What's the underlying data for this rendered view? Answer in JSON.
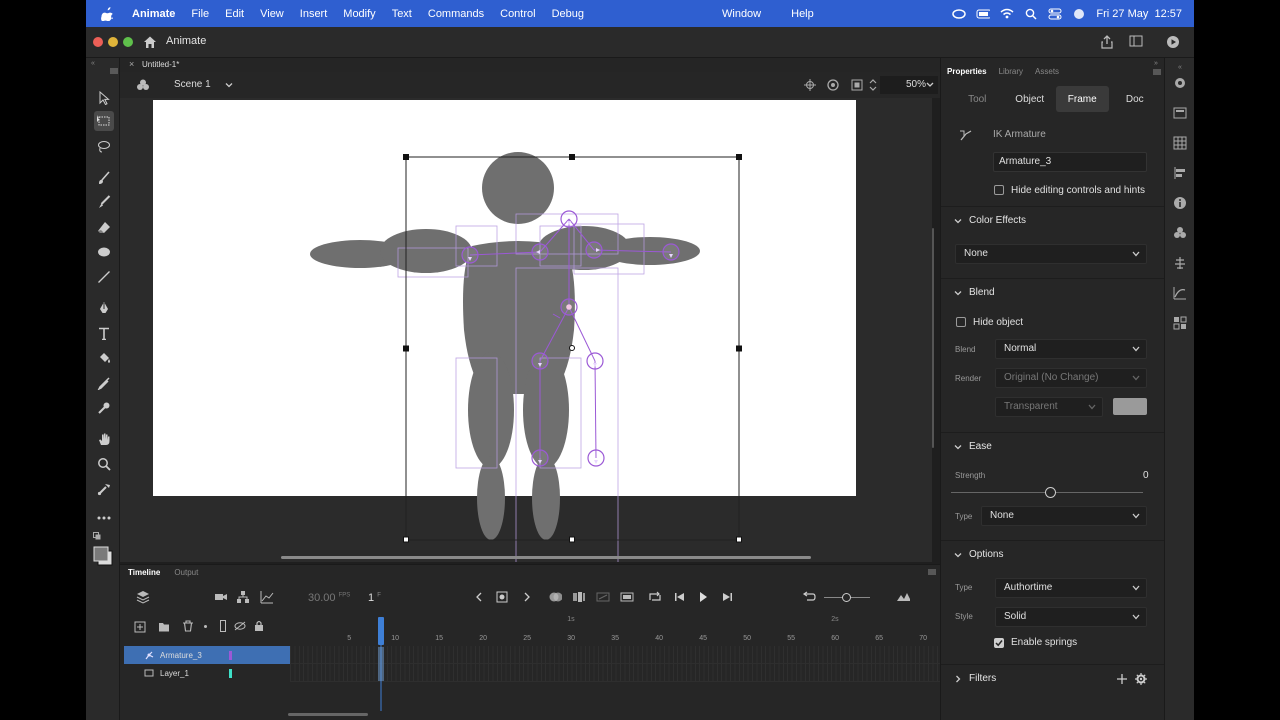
{
  "menubar": {
    "app_name": "Animate",
    "items": [
      "File",
      "Edit",
      "View",
      "Insert",
      "Modify",
      "Text",
      "Commands",
      "Control",
      "Debug"
    ],
    "right_items": [
      "Window",
      "Help"
    ],
    "clock": "Fri 27 May  12:57"
  },
  "titlebar": {
    "title": "Animate"
  },
  "document": {
    "tab_name": "Untitled-1*"
  },
  "scenebar": {
    "scene": "Scene 1",
    "zoom": "50%"
  },
  "timeline": {
    "tabs": [
      "Timeline",
      "Output"
    ],
    "fps": "30.00",
    "fps_unit": "FPS",
    "frame": "1",
    "frame_unit": "F",
    "ruler_numbers": [
      "5",
      "10",
      "15",
      "20",
      "25",
      "30",
      "35",
      "40",
      "45",
      "50",
      "55",
      "60",
      "65",
      "70"
    ],
    "ruler_seconds": [
      "1s",
      "2s"
    ],
    "layers": [
      {
        "name": "Armature_3",
        "selected": true,
        "mark_color": "#9b59d6"
      },
      {
        "name": "Layer_1",
        "selected": false,
        "mark_color": "#3ee0c8"
      }
    ]
  },
  "properties": {
    "tabs": [
      "Properties",
      "Library",
      "Assets"
    ],
    "segments": [
      "Tool",
      "Object",
      "Frame",
      "Doc"
    ],
    "active_segment": "Frame",
    "ik_label": "IK Armature",
    "armature_name": "Armature_3",
    "hide_controls_label": "Hide editing controls and hints",
    "color_effects": {
      "title": "Color Effects",
      "value": "None"
    },
    "blend": {
      "title": "Blend",
      "hide_object_label": "Hide object",
      "blend_label": "Blend",
      "blend_value": "Normal",
      "render_label": "Render",
      "render_value": "Original (No Change)",
      "transparent_value": "Transparent"
    },
    "ease": {
      "title": "Ease",
      "strength_label": "Strength",
      "strength_value": "0",
      "type_label": "Type",
      "type_value": "None"
    },
    "options": {
      "title": "Options",
      "type_label": "Type",
      "type_value": "Authortime",
      "style_label": "Style",
      "style_value": "Solid",
      "springs_label": "Enable springs",
      "springs_checked": true
    },
    "filters": {
      "title": "Filters"
    }
  },
  "colors": {
    "menubar": "#2f5fd0",
    "accent": "#3e6fb3",
    "figure": "#6f6f6f",
    "bone": "#9b59d6"
  }
}
